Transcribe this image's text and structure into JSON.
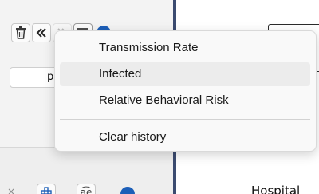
{
  "left_panel": {
    "toolbar": {
      "delete_icon": "trash-icon",
      "back_icon": "double-chevron-left-icon",
      "forward_icon": "double-chevron-right-icon",
      "history_icon": "history-list-icon",
      "help_icon": "help-icon",
      "help_glyph": "?"
    },
    "field": {
      "value": "p"
    },
    "lower_toolbar": {
      "close_glyph": "×",
      "add_icon": "add-node-icon",
      "rename_glyph": "a͡e",
      "help_glyph": "?"
    }
  },
  "right_panel": {
    "node_label": "Hospital"
  },
  "history_menu": {
    "items": [
      {
        "label": "Transmission Rate"
      },
      {
        "label": "Infected"
      },
      {
        "label": "Relative Behavioral Risk"
      }
    ],
    "clear_label": "Clear history"
  },
  "colors": {
    "accent_blue": "#1d5fb8",
    "divider": "#3b4b70",
    "menu_bg": "#f9f9f9",
    "hover_bg": "#ececec"
  }
}
